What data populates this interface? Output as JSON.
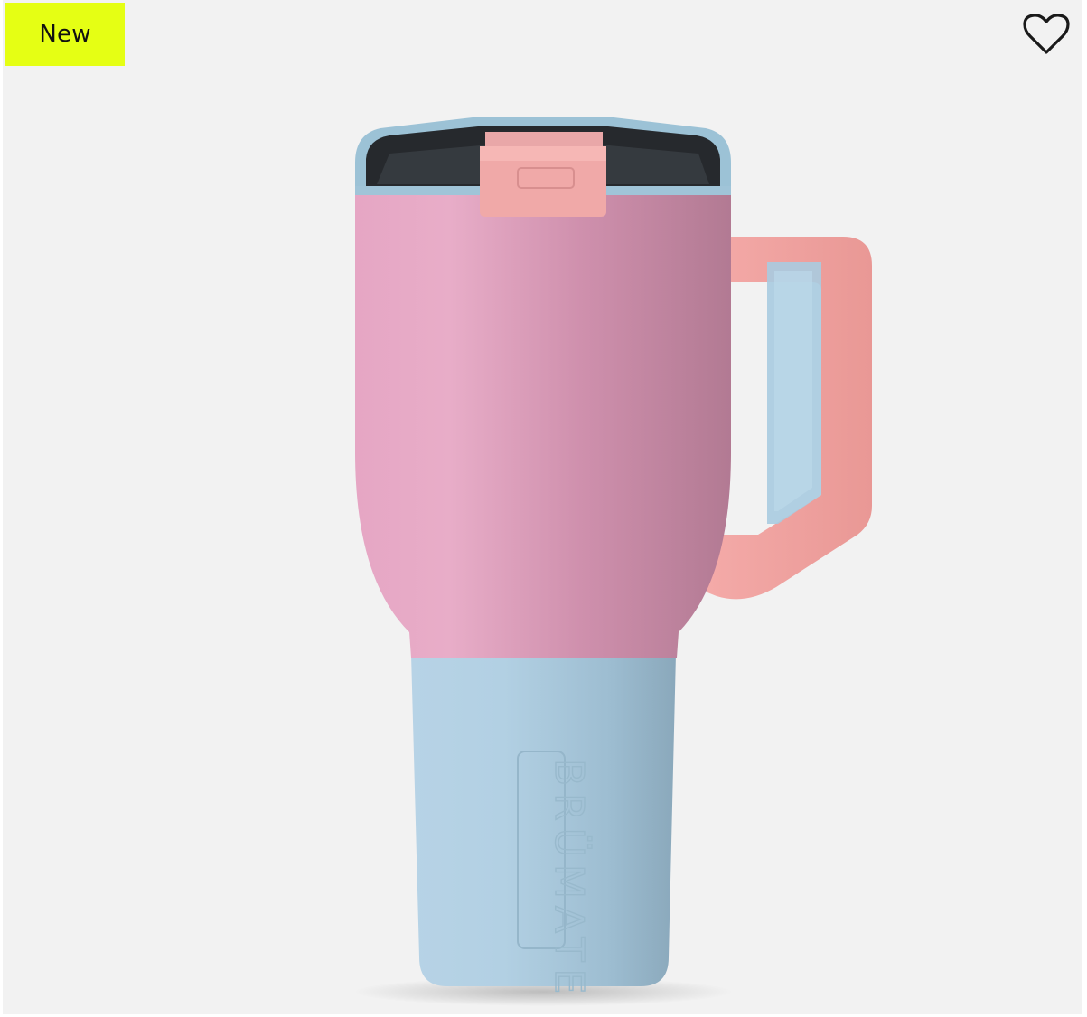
{
  "badge": {
    "label": "New",
    "color": "#e5ff14"
  },
  "wishlist": {
    "icon": "heart-outline-icon"
  },
  "product": {
    "engraving": "BRÜMATE",
    "colors": {
      "body": "#d99ab8",
      "base": "#a9cbe0",
      "handle": "#f2a3a0",
      "lid": "#232528"
    }
  }
}
